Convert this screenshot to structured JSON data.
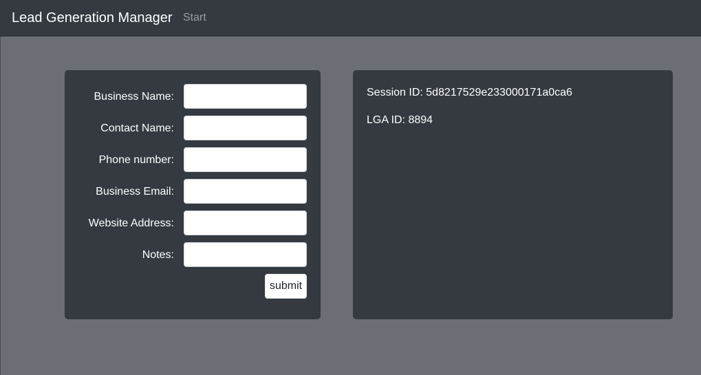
{
  "navbar": {
    "brand": "Lead Generation Manager",
    "links": [
      {
        "label": "Start"
      }
    ]
  },
  "form": {
    "fields": [
      {
        "label": "Business Name:",
        "value": "",
        "placeholder": ""
      },
      {
        "label": "Contact Name:",
        "value": "",
        "placeholder": ""
      },
      {
        "label": "Phone number:",
        "value": "",
        "placeholder": ""
      },
      {
        "label": "Business Email:",
        "value": "",
        "placeholder": ""
      },
      {
        "label": "Website Address:",
        "value": "",
        "placeholder": ""
      },
      {
        "label": "Notes:",
        "value": "",
        "placeholder": ""
      }
    ],
    "submit_label": "submit"
  },
  "info": {
    "session_label": "Session ID:",
    "session_id": "5d8217529e233000171a0ca6",
    "lga_label": "LGA ID:",
    "lga_id": "8894"
  },
  "colors": {
    "navbar_bg": "#343a40",
    "page_bg": "#6b6e75",
    "panel_bg": "#343a40",
    "text_primary": "#ffffff",
    "text_muted": "#9a9da1"
  }
}
